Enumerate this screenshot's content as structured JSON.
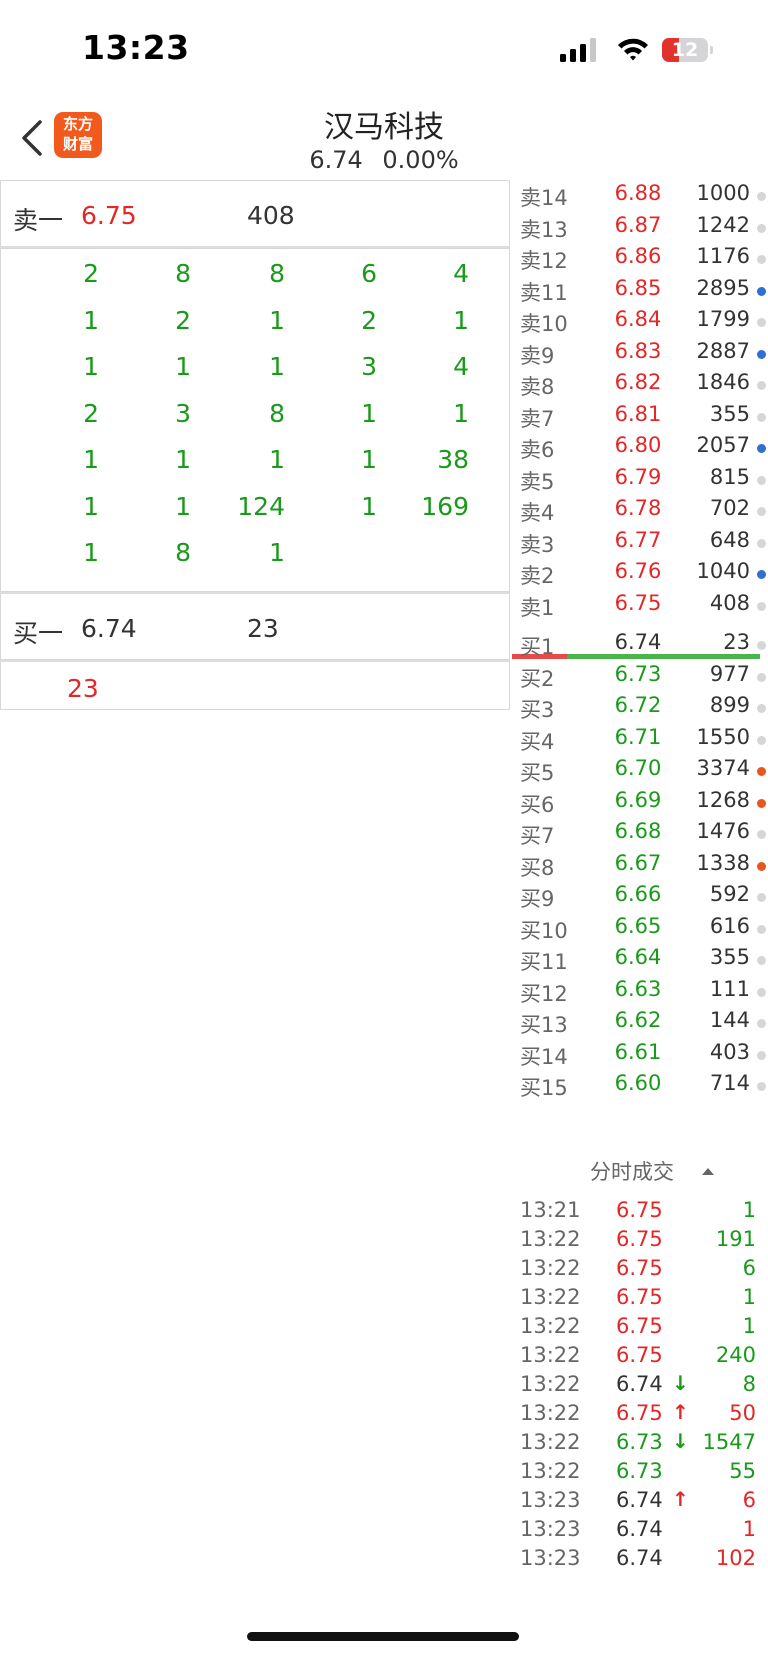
{
  "status_bar": {
    "time": "13:23",
    "battery": "12",
    "battery_level": 0.12
  },
  "header": {
    "back_icon": "chevron-left-icon",
    "logo_line1": "东方",
    "logo_line2": "财富",
    "title": "汉马科技",
    "price": "6.74",
    "change": "0.00%"
  },
  "left_panel": {
    "sell_label": "卖一",
    "sell_price": "6.75",
    "sell_volume": "408",
    "queue": [
      [
        "2",
        "8",
        "8",
        "6",
        "4"
      ],
      [
        "1",
        "2",
        "1",
        "2",
        "1"
      ],
      [
        "1",
        "1",
        "1",
        "3",
        "4"
      ],
      [
        "2",
        "3",
        "8",
        "1",
        "1"
      ],
      [
        "1",
        "1",
        "1",
        "1",
        "38"
      ],
      [
        "1",
        "1",
        "124",
        "1",
        "169"
      ],
      [
        "1",
        "8",
        "1"
      ]
    ],
    "buy_label": "买一",
    "buy_price": "6.74",
    "buy_volume": "23",
    "buy_queue_value": "23"
  },
  "order_book": {
    "sells": [
      {
        "label": "卖14",
        "price": "6.88",
        "vol": "1000",
        "dot": "gray"
      },
      {
        "label": "卖13",
        "price": "6.87",
        "vol": "1242",
        "dot": "gray"
      },
      {
        "label": "卖12",
        "price": "6.86",
        "vol": "1176",
        "dot": "gray"
      },
      {
        "label": "卖11",
        "price": "6.85",
        "vol": "2895",
        "dot": "blue"
      },
      {
        "label": "卖10",
        "price": "6.84",
        "vol": "1799",
        "dot": "gray"
      },
      {
        "label": "卖9",
        "price": "6.83",
        "vol": "2887",
        "dot": "blue"
      },
      {
        "label": "卖8",
        "price": "6.82",
        "vol": "1846",
        "dot": "gray"
      },
      {
        "label": "卖7",
        "price": "6.81",
        "vol": "355",
        "dot": "gray"
      },
      {
        "label": "卖6",
        "price": "6.80",
        "vol": "2057",
        "dot": "blue"
      },
      {
        "label": "卖5",
        "price": "6.79",
        "vol": "815",
        "dot": "gray"
      },
      {
        "label": "卖4",
        "price": "6.78",
        "vol": "702",
        "dot": "gray"
      },
      {
        "label": "卖3",
        "price": "6.77",
        "vol": "648",
        "dot": "gray"
      },
      {
        "label": "卖2",
        "price": "6.76",
        "vol": "1040",
        "dot": "blue"
      },
      {
        "label": "卖1",
        "price": "6.75",
        "vol": "408",
        "dot": "gray"
      }
    ],
    "buys": [
      {
        "label": "买1",
        "price": "6.74",
        "vol": "23",
        "dot": "gray",
        "color": "neutral"
      },
      {
        "label": "买2",
        "price": "6.73",
        "vol": "977",
        "dot": "gray",
        "color": "green"
      },
      {
        "label": "买3",
        "price": "6.72",
        "vol": "899",
        "dot": "gray",
        "color": "green"
      },
      {
        "label": "买4",
        "price": "6.71",
        "vol": "1550",
        "dot": "gray",
        "color": "green"
      },
      {
        "label": "买5",
        "price": "6.70",
        "vol": "3374",
        "dot": "orange",
        "color": "green"
      },
      {
        "label": "买6",
        "price": "6.69",
        "vol": "1268",
        "dot": "orange",
        "color": "green"
      },
      {
        "label": "买7",
        "price": "6.68",
        "vol": "1476",
        "dot": "gray",
        "color": "green"
      },
      {
        "label": "买8",
        "price": "6.67",
        "vol": "1338",
        "dot": "orange",
        "color": "green"
      },
      {
        "label": "买9",
        "price": "6.66",
        "vol": "592",
        "dot": "gray",
        "color": "green"
      },
      {
        "label": "买10",
        "price": "6.65",
        "vol": "616",
        "dot": "gray",
        "color": "green"
      },
      {
        "label": "买11",
        "price": "6.64",
        "vol": "355",
        "dot": "gray",
        "color": "green"
      },
      {
        "label": "买12",
        "price": "6.63",
        "vol": "111",
        "dot": "gray",
        "color": "green"
      },
      {
        "label": "买13",
        "price": "6.62",
        "vol": "144",
        "dot": "gray",
        "color": "green"
      },
      {
        "label": "买14",
        "price": "6.61",
        "vol": "403",
        "dot": "gray",
        "color": "green"
      },
      {
        "label": "买15",
        "price": "6.60",
        "vol": "714",
        "dot": "gray",
        "color": "green"
      }
    ]
  },
  "time_sales": {
    "title": "分时成交",
    "rows": [
      {
        "time": "13:21",
        "price": "6.75",
        "arrow": "",
        "vol": "1",
        "pcolor": "red",
        "vcolor": "green"
      },
      {
        "time": "13:22",
        "price": "6.75",
        "arrow": "",
        "vol": "191",
        "pcolor": "red",
        "vcolor": "green"
      },
      {
        "time": "13:22",
        "price": "6.75",
        "arrow": "",
        "vol": "6",
        "pcolor": "red",
        "vcolor": "green"
      },
      {
        "time": "13:22",
        "price": "6.75",
        "arrow": "",
        "vol": "1",
        "pcolor": "red",
        "vcolor": "green"
      },
      {
        "time": "13:22",
        "price": "6.75",
        "arrow": "",
        "vol": "1",
        "pcolor": "red",
        "vcolor": "green"
      },
      {
        "time": "13:22",
        "price": "6.75",
        "arrow": "",
        "vol": "240",
        "pcolor": "red",
        "vcolor": "green"
      },
      {
        "time": "13:22",
        "price": "6.74",
        "arrow": "↓",
        "vol": "8",
        "pcolor": "neutral",
        "vcolor": "green"
      },
      {
        "time": "13:22",
        "price": "6.75",
        "arrow": "↑",
        "vol": "50",
        "pcolor": "red",
        "vcolor": "red"
      },
      {
        "time": "13:22",
        "price": "6.73",
        "arrow": "↓",
        "vol": "1547",
        "pcolor": "green",
        "vcolor": "green"
      },
      {
        "time": "13:22",
        "price": "6.73",
        "arrow": "",
        "vol": "55",
        "pcolor": "green",
        "vcolor": "green"
      },
      {
        "time": "13:23",
        "price": "6.74",
        "arrow": "↑",
        "vol": "6",
        "pcolor": "neutral",
        "vcolor": "red"
      },
      {
        "time": "13:23",
        "price": "6.74",
        "arrow": "",
        "vol": "1",
        "pcolor": "neutral",
        "vcolor": "red"
      },
      {
        "time": "13:23",
        "price": "6.74",
        "arrow": "",
        "vol": "102",
        "pcolor": "neutral",
        "vcolor": "red"
      }
    ]
  },
  "colors": {
    "red": "#e32727",
    "green": "#1a9a1a",
    "neutral": "#333333",
    "dot_gray": "#d6d6d6",
    "dot_blue": "#2e6fd1",
    "dot_orange": "#e8561f"
  }
}
